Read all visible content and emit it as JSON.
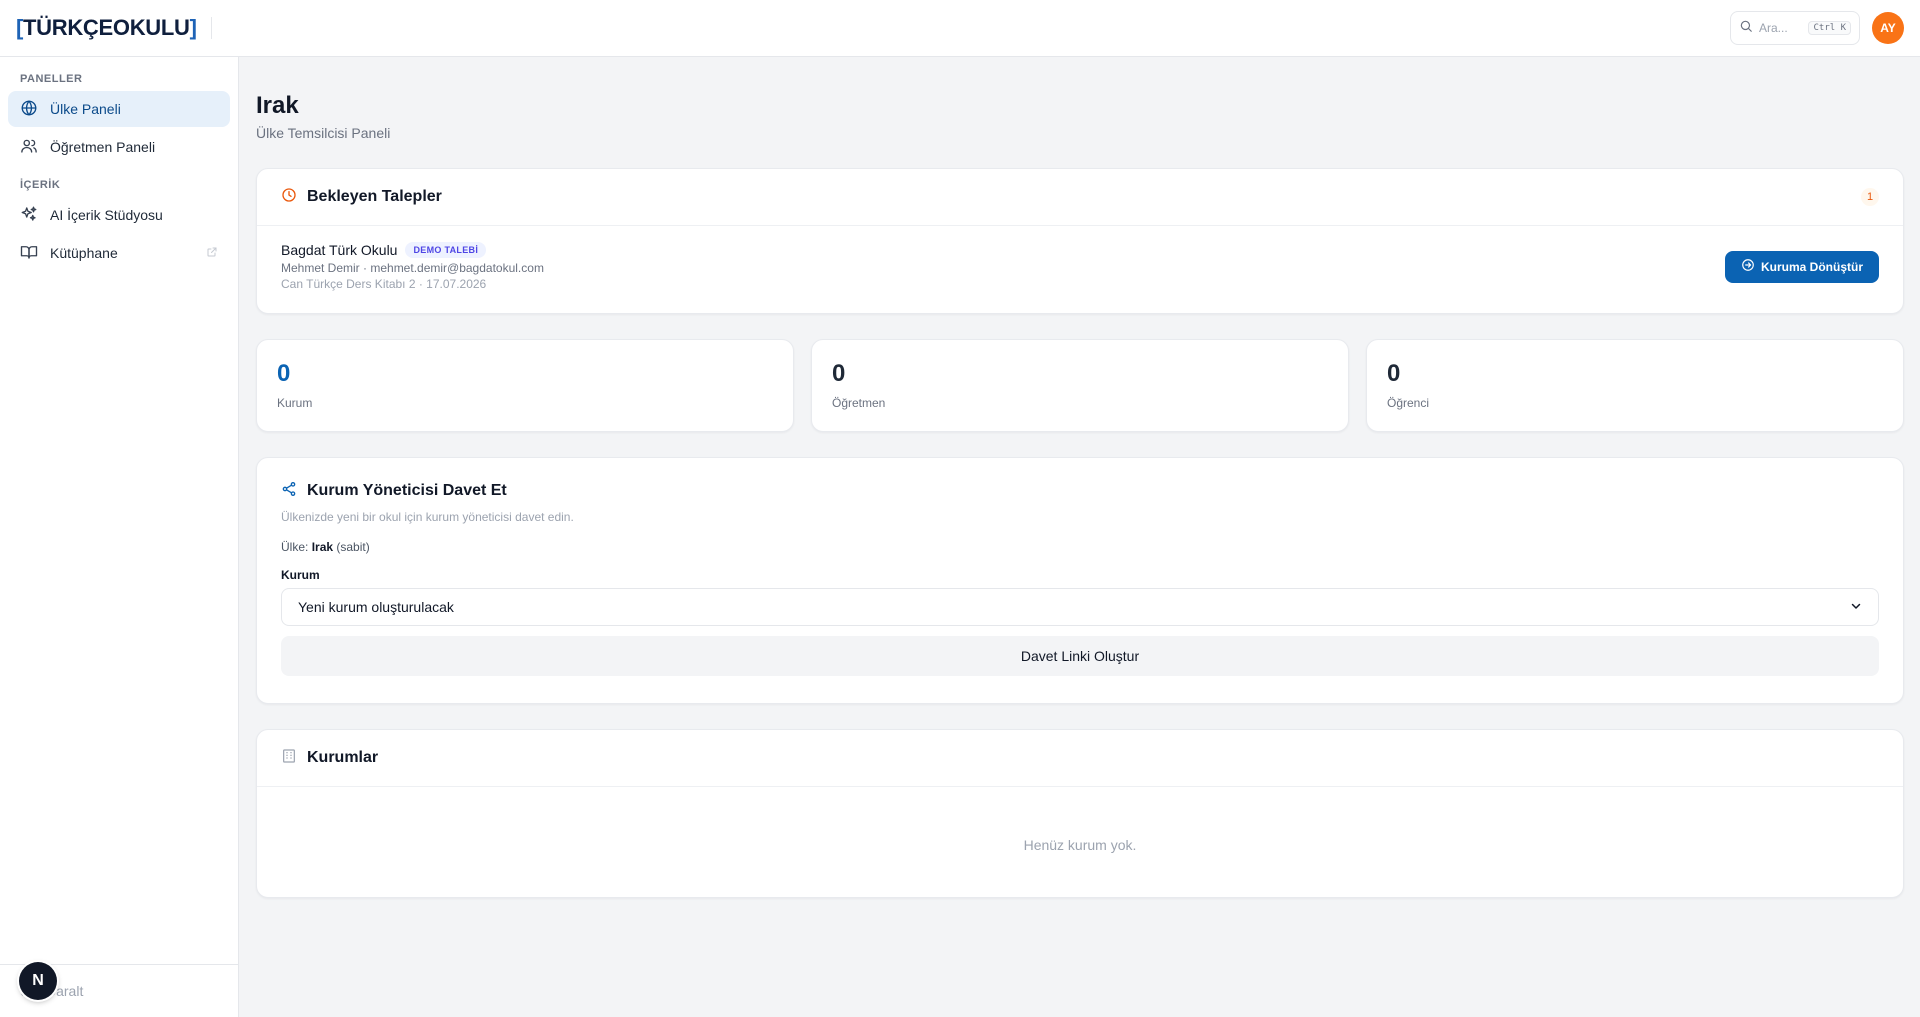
{
  "header": {
    "logo_left_bracket": "[",
    "logo_text": "TÜRKÇEOKULU",
    "logo_right_bracket": "]",
    "search_placeholder": "Ara...",
    "search_shortcut": "Ctrl K",
    "avatar_initials": "AY"
  },
  "sidebar": {
    "section_panels": "PANELLER",
    "section_content": "İÇERİK",
    "items": [
      {
        "label": "Ülke Paneli",
        "icon": "globe-icon",
        "active": true
      },
      {
        "label": "Öğretmen Paneli",
        "icon": "users-icon",
        "active": false
      },
      {
        "label": "AI İçerik Stüdyosu",
        "icon": "sparkles-icon",
        "active": false
      },
      {
        "label": "Kütüphane",
        "icon": "book-icon",
        "active": false
      }
    ],
    "collapse_label": "Daralt",
    "n_badge": "N"
  },
  "page": {
    "title": "Irak",
    "subtitle": "Ülke Temsilcisi Paneli"
  },
  "pending": {
    "title": "Bekleyen Talepler",
    "count": "1",
    "request": {
      "school": "Bagdat Türk Okulu",
      "badge": "DEMO TALEBİ",
      "contact": "Mehmet Demir · mehmet.demir@bagdatokul.com",
      "detail": "Can Türkçe Ders Kitabı 2 · 17.07.2026",
      "action": "Kuruma Dönüştür"
    }
  },
  "stats": [
    {
      "value": "0",
      "label": "Kurum"
    },
    {
      "value": "0",
      "label": "Öğretmen"
    },
    {
      "value": "0",
      "label": "Öğrenci"
    }
  ],
  "invite": {
    "title": "Kurum Yöneticisi Davet Et",
    "description": "Ülkenizde yeni bir okul için kurum yöneticisi davet edin.",
    "country_prefix": "Ülke:",
    "country_name": "Irak",
    "country_suffix": "(sabit)",
    "institution_label": "Kurum",
    "institution_selected": "Yeni kurum oluşturulacak",
    "button": "Davet Linki Oluştur"
  },
  "institutions": {
    "title": "Kurumlar",
    "empty": "Henüz kurum yok."
  },
  "colors": {
    "accent": "#0b63b3",
    "avatar": "#f97316",
    "pending_icon": "#ea580c",
    "demo_badge": "#4f46e5"
  }
}
